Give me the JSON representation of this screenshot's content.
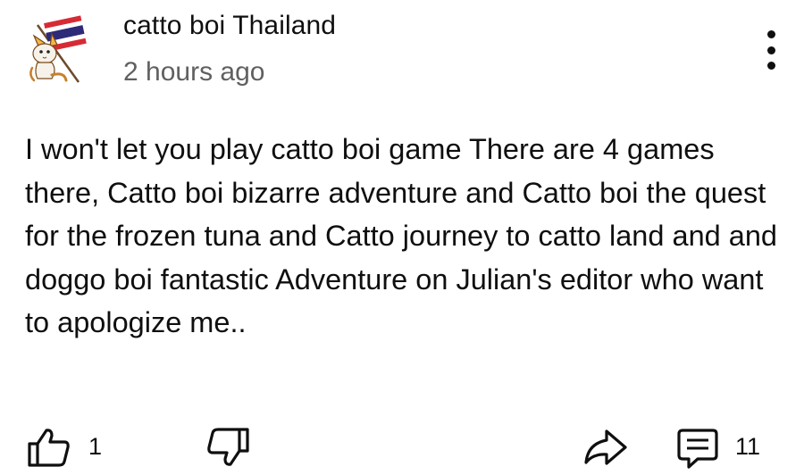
{
  "comment": {
    "author": "catto boi Thailand",
    "timestamp": "2 hours ago",
    "avatar_icon": "cat-with-thai-flag-avatar",
    "text": "I won't let you play catto boi game There are 4 games there, Catto boi bizarre adventure and Catto boi the quest for the frozen tuna and Catto journey to catto land and and doggo boi fantastic Adventure on Julian's editor who want to apologize me..",
    "more_icon": "more-vert-icon"
  },
  "actions": {
    "like_icon": "thumbs-up-icon",
    "like_count": "1",
    "dislike_icon": "thumbs-down-icon",
    "share_icon": "share-arrow-icon",
    "reply_icon": "comment-icon",
    "reply_count": "11"
  },
  "colors": {
    "text": "#0f0f0f",
    "secondary_text": "#606060",
    "background": "#ffffff"
  }
}
